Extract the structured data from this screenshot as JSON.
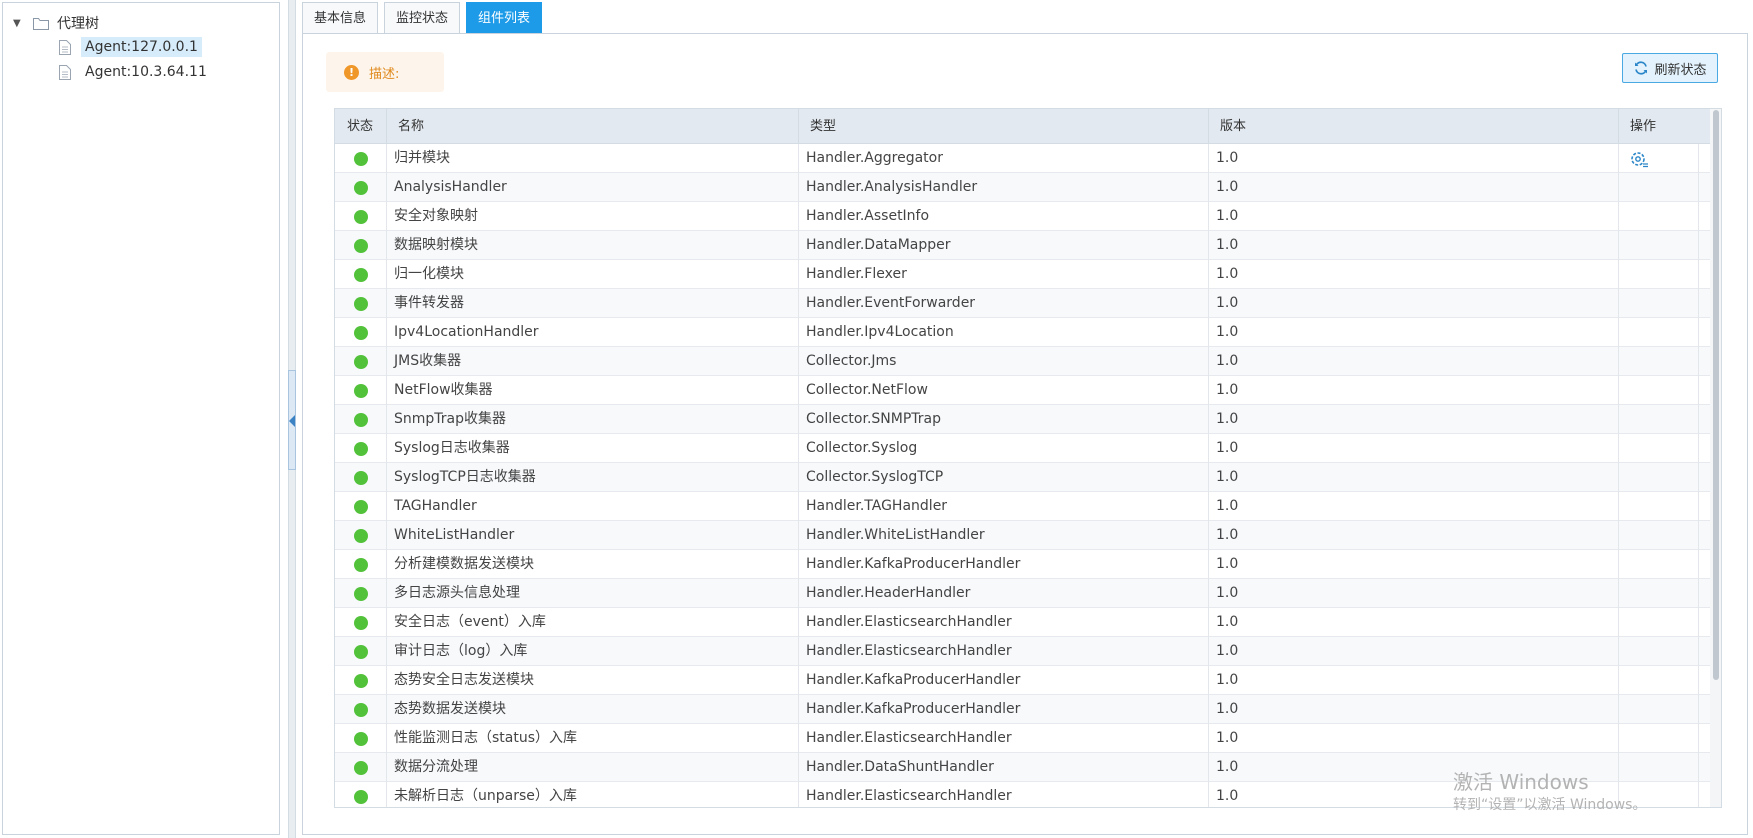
{
  "tree": {
    "root_label": "代理树",
    "items": [
      {
        "label": "Agent:127.0.0.1",
        "selected": true
      },
      {
        "label": "Agent:10.3.64.11",
        "selected": false
      }
    ]
  },
  "tabs": [
    {
      "label": "基本信息",
      "active": false
    },
    {
      "label": "监控状态",
      "active": false
    },
    {
      "label": "组件列表",
      "active": true
    }
  ],
  "description": {
    "label": "描述:"
  },
  "toolbar": {
    "refresh_label": "刷新状态"
  },
  "grid": {
    "columns": {
      "status": "状态",
      "name": "名称",
      "type": "类型",
      "version": "版本",
      "action": "操作"
    },
    "rows": [
      {
        "status": "running",
        "name": "归并模块",
        "type": "Handler.Aggregator",
        "version": "1.0",
        "action": true
      },
      {
        "status": "running",
        "name": "AnalysisHandler",
        "type": "Handler.AnalysisHandler",
        "version": "1.0"
      },
      {
        "status": "running",
        "name": "安全对象映射",
        "type": "Handler.AssetInfo",
        "version": "1.0"
      },
      {
        "status": "running",
        "name": "数据映射模块",
        "type": "Handler.DataMapper",
        "version": "1.0"
      },
      {
        "status": "running",
        "name": "归一化模块",
        "type": "Handler.Flexer",
        "version": "1.0"
      },
      {
        "status": "running",
        "name": "事件转发器",
        "type": "Handler.EventForwarder",
        "version": "1.0"
      },
      {
        "status": "running",
        "name": "Ipv4LocationHandler",
        "type": "Handler.Ipv4Location",
        "version": "1.0"
      },
      {
        "status": "running",
        "name": "JMS收集器",
        "type": "Collector.Jms",
        "version": "1.0"
      },
      {
        "status": "running",
        "name": "NetFlow收集器",
        "type": "Collector.NetFlow",
        "version": "1.0"
      },
      {
        "status": "running",
        "name": "SnmpTrap收集器",
        "type": "Collector.SNMPTrap",
        "version": "1.0"
      },
      {
        "status": "running",
        "name": "Syslog日志收集器",
        "type": "Collector.Syslog",
        "version": "1.0"
      },
      {
        "status": "running",
        "name": "SyslogTCP日志收集器",
        "type": "Collector.SyslogTCP",
        "version": "1.0"
      },
      {
        "status": "running",
        "name": "TAGHandler",
        "type": "Handler.TAGHandler",
        "version": "1.0"
      },
      {
        "status": "running",
        "name": "WhiteListHandler",
        "type": "Handler.WhiteListHandler",
        "version": "1.0"
      },
      {
        "status": "running",
        "name": "分析建模数据发送模块",
        "type": "Handler.KafkaProducerHandler",
        "version": "1.0"
      },
      {
        "status": "running",
        "name": "多日志源头信息处理",
        "type": "Handler.HeaderHandler",
        "version": "1.0"
      },
      {
        "status": "running",
        "name": "安全日志（event）入库",
        "type": "Handler.ElasticsearchHandler",
        "version": "1.0"
      },
      {
        "status": "running",
        "name": "审计日志（log）入库",
        "type": "Handler.ElasticsearchHandler",
        "version": "1.0"
      },
      {
        "status": "running",
        "name": "态势安全日志发送模块",
        "type": "Handler.KafkaProducerHandler",
        "version": "1.0"
      },
      {
        "status": "running",
        "name": "态势数据发送模块",
        "type": "Handler.KafkaProducerHandler",
        "version": "1.0"
      },
      {
        "status": "running",
        "name": "性能监测日志（status）入库",
        "type": "Handler.ElasticsearchHandler",
        "version": "1.0"
      },
      {
        "status": "running",
        "name": "数据分流处理",
        "type": "Handler.DataShuntHandler",
        "version": "1.0"
      },
      {
        "status": "running",
        "name": "未解析日志（unparse）入库",
        "type": "Handler.ElasticsearchHandler",
        "version": "1.0"
      }
    ]
  },
  "colors": {
    "accent": "#1e9be8",
    "status_running": "#52c23a",
    "warning": "#f0972a"
  },
  "icons": {
    "tree_caret": "caret-down-icon",
    "tree_root": "folder-icon",
    "tree_item": "file-icon",
    "description": "warning-icon",
    "refresh": "refresh-icon",
    "action": "gear-icon",
    "status": "status-dot"
  },
  "watermark": {
    "line1": "激活 Windows",
    "line2": "转到“设置”以激活 Windows。"
  }
}
